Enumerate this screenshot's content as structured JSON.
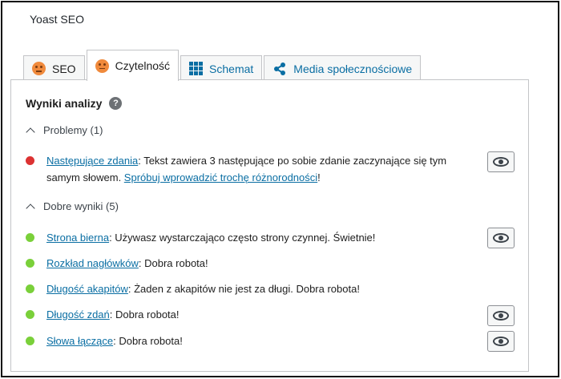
{
  "panel": {
    "title": "Yoast SEO"
  },
  "tabs": [
    {
      "label": "SEO",
      "icon": "sad-face-icon"
    },
    {
      "label": "Czytelność",
      "icon": "sad-face-icon"
    },
    {
      "label": "Schemat",
      "icon": "grid-icon"
    },
    {
      "label": "Media społecznościowe",
      "icon": "share-icon"
    }
  ],
  "analysis": {
    "heading": "Wyniki analizy",
    "help_icon": "?",
    "problems": {
      "label": "Problemy (1)",
      "items": [
        {
          "status": "bad",
          "link": "Następujące zdania",
          "text": ": Tekst zawiera 3 następujące po sobie zdanie zaczynające się tym samym słowem. ",
          "link2": "Spróbuj wprowadzić trochę różnorodności",
          "text2": "!"
        }
      ]
    },
    "good": {
      "label": "Dobre wyniki (5)",
      "items": [
        {
          "status": "good",
          "link": "Strona bierna",
          "text": ": Używasz wystarczająco często strony czynnej. Świetnie!"
        },
        {
          "status": "good",
          "link": "Rozkład nagłówków",
          "text": ": Dobra robota!"
        },
        {
          "status": "good",
          "link": "Długość akapitów",
          "text": ": Żaden z akapitów nie jest za długi. Dobra robota!"
        },
        {
          "status": "good",
          "link": "Długość zdań",
          "text": ": Dobra robota!"
        },
        {
          "status": "good",
          "link": "Słowa łączące",
          "text": ": Dobra robota!"
        }
      ]
    }
  },
  "colors": {
    "bad": "#dc3232",
    "good": "#7ad03a",
    "link": "#0a6ea3",
    "tab_icon": "#f08a3c"
  }
}
